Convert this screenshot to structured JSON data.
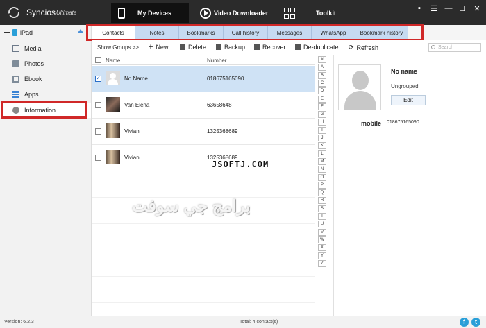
{
  "app": {
    "name": "Syncios",
    "edition": "Ultimate"
  },
  "nav": {
    "devices": "My Devices",
    "video": "Video Downloader",
    "toolkit": "Toolkit"
  },
  "window_controls": {
    "feedback": "▪",
    "settings": "☰",
    "minimize": "—",
    "maximize": "☐",
    "close": "✕"
  },
  "sidebar": {
    "device": "iPad",
    "items": [
      {
        "label": "Media"
      },
      {
        "label": "Photos"
      },
      {
        "label": "Ebook"
      },
      {
        "label": "Apps"
      },
      {
        "label": "Information"
      }
    ],
    "selected": "Information"
  },
  "tabs": [
    "Contacts",
    "Notes",
    "Bookmarks",
    "Call history",
    "Messages",
    "WhatsApp",
    "Bookmark history"
  ],
  "active_tab": "Contacts",
  "toolbar": {
    "show_groups": "Show Groups >>",
    "new": "New",
    "delete": "Delete",
    "backup": "Backup",
    "recover": "Recover",
    "deduplicate": "De-duplicate",
    "refresh": "Refresh",
    "search_placeholder": "Search"
  },
  "table": {
    "col_name": "Name",
    "col_number": "Number",
    "rows": [
      {
        "name": "No Name",
        "number": "018675165090",
        "checked": true
      },
      {
        "name": "Van Elena",
        "number": "63658648",
        "checked": false
      },
      {
        "name": "Vivian",
        "number": "1325368689",
        "checked": false
      },
      {
        "name": "Vivian",
        "number": "1325368689",
        "checked": false
      }
    ]
  },
  "alphabet": [
    "#",
    "A",
    "B",
    "C",
    "D",
    "E",
    "F",
    "G",
    "H",
    "I",
    "J",
    "K",
    "L",
    "M",
    "N",
    "O",
    "P",
    "Q",
    "R",
    "S",
    "T",
    "U",
    "V",
    "W",
    "X",
    "Y",
    "Z"
  ],
  "detail": {
    "name": "No name",
    "group": "Ungrouped",
    "edit": "Edit",
    "field_label": "mobile",
    "field_value": "018675165090"
  },
  "watermark": {
    "latin": "JSOFTJ.COM",
    "arabic": "برامج جي سوفت"
  },
  "status": {
    "version": "Version: 6.2.3",
    "total": "Total: 4 contact(s)"
  },
  "colors": {
    "titlebar": "#2b2b2b",
    "tab": "#c6daf2",
    "selected_row": "#cfe2f5",
    "highlight": "#d02828",
    "accent": "#2a9fd8"
  }
}
